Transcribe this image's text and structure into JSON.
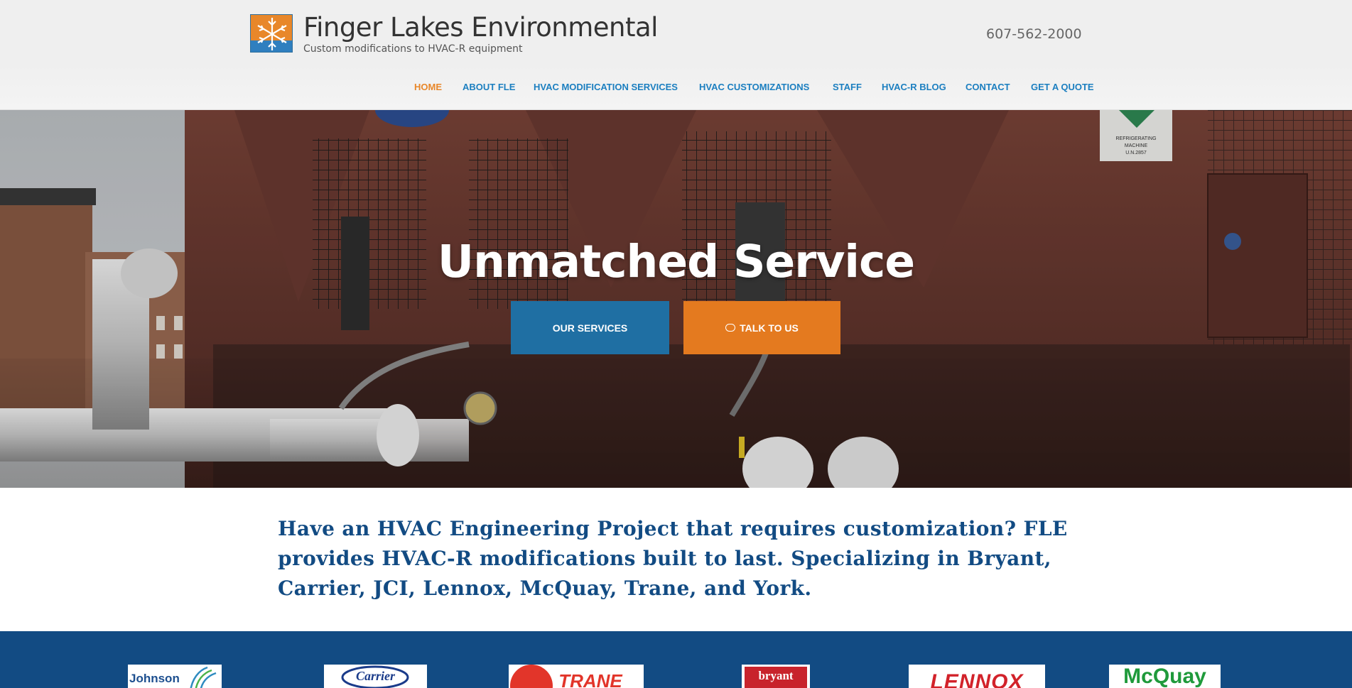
{
  "site": {
    "title": "Finger Lakes Environmental",
    "tagline": "Custom modifications to HVAC-R equipment",
    "phone": "607-562-2000",
    "logo_icon": "snowflake-logo-icon"
  },
  "nav": {
    "items": [
      {
        "label": "HOME",
        "active": true
      },
      {
        "label": "ABOUT FLE",
        "active": false
      },
      {
        "label": "HVAC MODIFICATION SERVICES",
        "active": false
      },
      {
        "label": "HVAC CUSTOMIZATIONS",
        "active": false
      },
      {
        "label": "STAFF",
        "active": false
      },
      {
        "label": "HVAC-R BLOG",
        "active": false
      },
      {
        "label": "CONTACT",
        "active": false
      },
      {
        "label": "GET A QUOTE",
        "active": false
      }
    ]
  },
  "hero": {
    "title": "Unmatched Service",
    "buttons": {
      "services": "OUR SERVICES",
      "talk": "TALK TO US"
    },
    "signs": {
      "hazmat": "REFRIGERATING MACHINE U.N.2857"
    }
  },
  "intro": {
    "text": "Have an HVAC Engineering Project that requires customization? FLE provides HVAC-R modifications built to last. Specializing in Bryant, Carrier, JCI, Lennox, McQuay, Trane, and York."
  },
  "brands": {
    "logos": [
      "Johnson",
      "Carrier",
      "TRANE",
      "bryant",
      "LENNOX",
      "McQuay"
    ]
  },
  "colors": {
    "accent_orange": "#e8872a",
    "nav_blue": "#1c7fc0",
    "brand_blue": "#124b83",
    "button_blue": "#1f6fa3",
    "button_orange": "#e47a1f"
  }
}
